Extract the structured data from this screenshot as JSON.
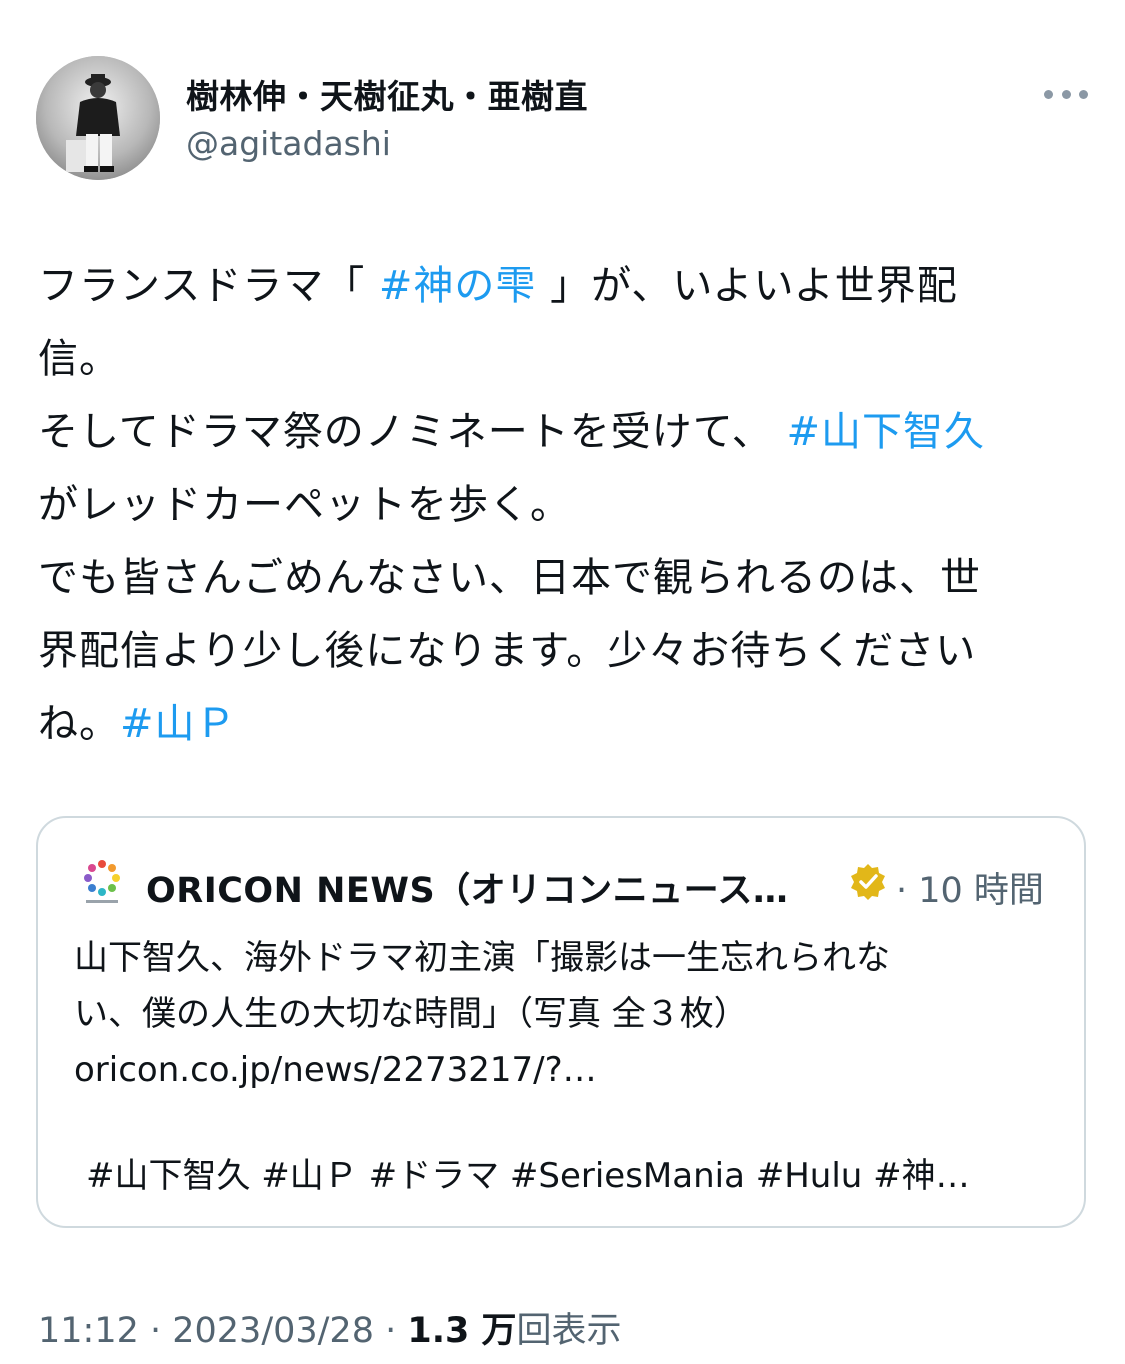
{
  "author": {
    "name": "樹林伸・天樹征丸・亜樹直",
    "handle": "@agitadashi"
  },
  "tweet": {
    "lines": [
      [
        {
          "text": "フランスドラマ「 "
        },
        {
          "text": "#神の雫",
          "hashtag": true
        },
        {
          "text": " 」が、いよいよ世界配"
        }
      ],
      [
        {
          "text": "信。"
        }
      ],
      [
        {
          "text": "そしてドラマ祭のノミネートを受けて、 "
        },
        {
          "text": "#山下智久",
          "hashtag": true
        }
      ],
      [
        {
          "text": "がレッドカーペットを歩く。"
        }
      ],
      [
        {
          "text": "でも皆さんごめんなさい、日本で観られるのは、世"
        }
      ],
      [
        {
          "text": "界配信より少し後になります。少々お待ちください"
        }
      ],
      [
        {
          "text": "ね。"
        },
        {
          "text": "#山Ｐ",
          "hashtag": true
        }
      ]
    ]
  },
  "quote": {
    "source_name": "ORICON NEWS（オリコンニュース…",
    "time": "· 10 時間",
    "lines": [
      "山下智久、海外ドラマ初主演「撮影は一生忘れられな",
      "い、僕の人生の大切な時間」（写真 全３枚）",
      "oricon.co.jp/news/2273217/?…"
    ],
    "tags": "#山下智久 #山Ｐ #ドラマ #SeriesMania #Hulu #神…"
  },
  "footer": {
    "time": "11:12 · 2023/03/28 · ",
    "views_count": "1.3 万",
    "views_label": "回表示"
  },
  "icons": {
    "more": "more-horizontal-icon",
    "verified": "gold-verified-badge-icon",
    "quote_logo": "oricon-logo"
  },
  "colors": {
    "hashtag": "#1d9bf0",
    "secondary_text": "#536471",
    "primary_text": "#0f1419",
    "border": "#cfd9de",
    "verified_gold": "#e2b719"
  }
}
